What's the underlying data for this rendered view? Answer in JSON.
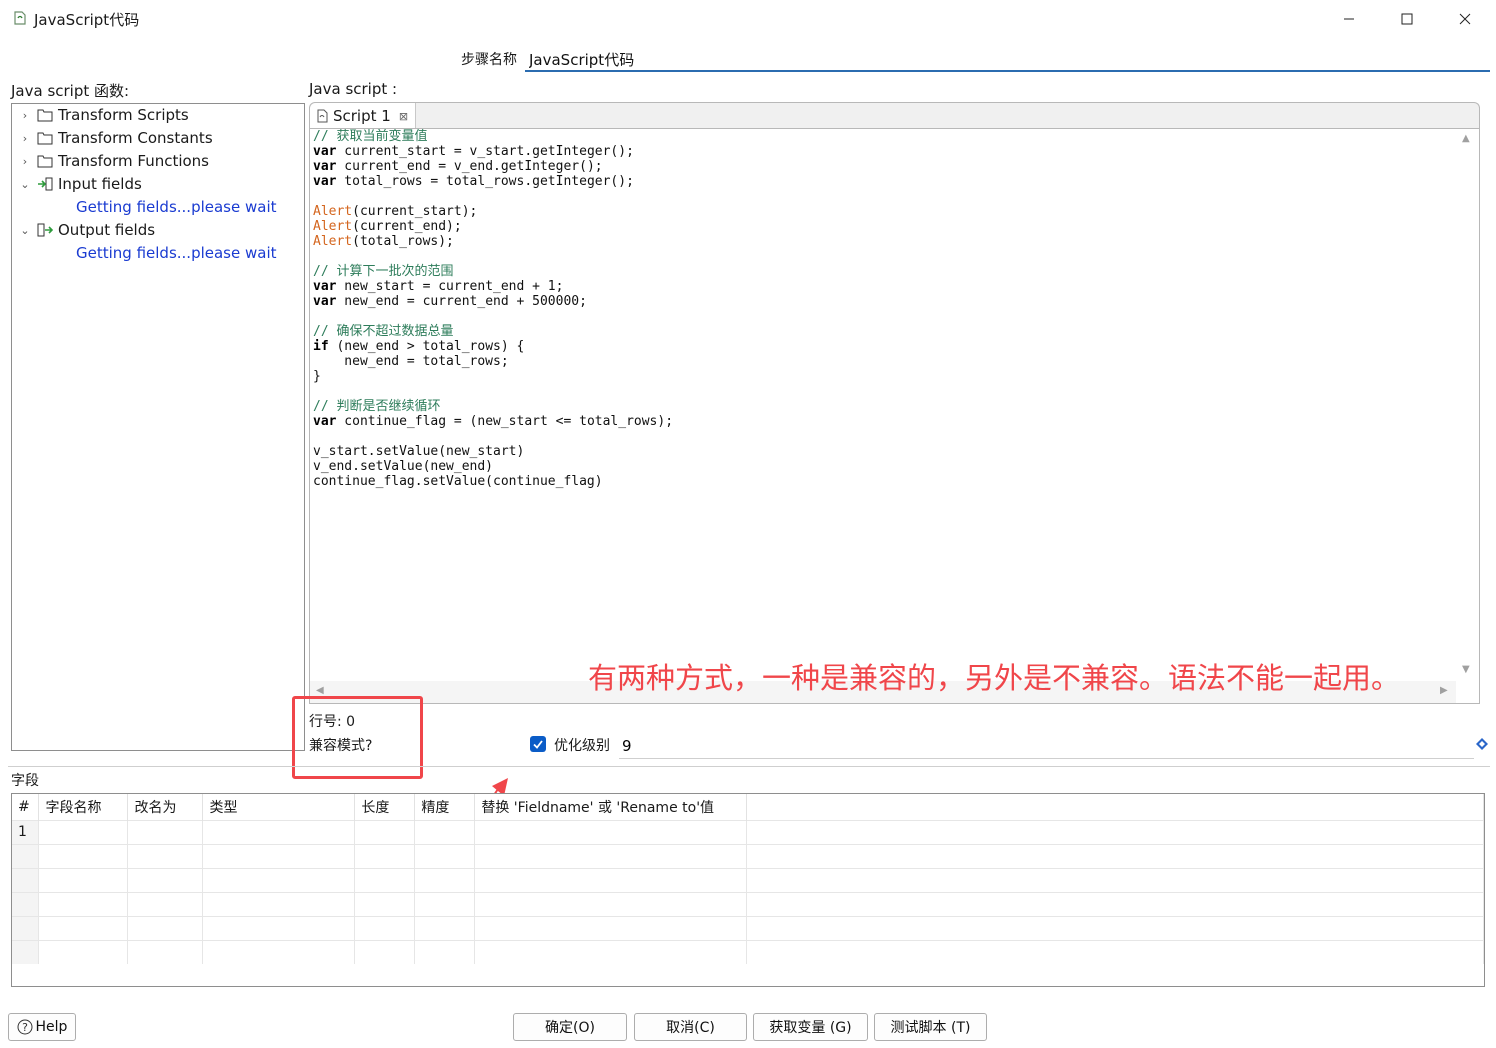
{
  "window": {
    "title": "JavaScript代码",
    "min_icon": "minimize-icon",
    "max_icon": "maximize-icon",
    "close_icon": "close-icon"
  },
  "step": {
    "label": "步骤名称",
    "value": "JavaScript代码"
  },
  "left_panel": {
    "label": "Java script 函数:",
    "tree": [
      {
        "label": "Transform Scripts",
        "icon": "folder-icon",
        "expanded": false
      },
      {
        "label": "Transform Constants",
        "icon": "folder-icon",
        "expanded": false
      },
      {
        "label": "Transform Functions",
        "icon": "folder-icon",
        "expanded": false
      },
      {
        "label": "Input fields",
        "icon": "input-fields-icon",
        "expanded": true,
        "child": "Getting fields...please wait"
      },
      {
        "label": "Output fields",
        "icon": "output-fields-icon",
        "expanded": true,
        "child": "Getting fields...please wait"
      }
    ]
  },
  "editor": {
    "label": "Java script :",
    "tab_label": "Script 1",
    "code_lines": [
      "// 获取当前变量值",
      "var current_start = v_start.getInteger();",
      "var current_end = v_end.getInteger();",
      "var total_rows = total_rows.getInteger();",
      "",
      "Alert(current_start);",
      "Alert(current_end);",
      "Alert(total_rows);",
      "",
      "// 计算下一批次的范围",
      "var new_start = current_end + 1;",
      "var new_end = current_end + 500000;",
      "",
      "// 确保不超过数据总量",
      "if (new_end > total_rows) {",
      "    new_end = total_rows;",
      "}",
      "",
      "// 判断是否继续循环",
      "var continue_flag = (new_start <= total_rows);",
      "",
      "v_start.setValue(new_start)",
      "v_end.setValue(new_end)",
      "continue_flag.setValue(continue_flag)"
    ]
  },
  "annotation": "有两种方式，一种是兼容的，另外是不兼容。语法不能一起用。",
  "status": {
    "line_number": "行号: 0",
    "compat_mode": "兼容模式?"
  },
  "optimization": {
    "checked": true,
    "label": "优化级别",
    "value": "9"
  },
  "fields": {
    "label": "字段",
    "columns": [
      "#",
      "字段名称",
      "改名为",
      "类型",
      "长度",
      "精度",
      "替换 'Fieldname' 或 'Rename to'值"
    ],
    "rows": [
      [
        "1",
        "",
        "",
        "",
        "",
        "",
        ""
      ],
      [
        "",
        "",
        "",
        "",
        "",
        "",
        ""
      ],
      [
        "",
        "",
        "",
        "",
        "",
        "",
        ""
      ],
      [
        "",
        "",
        "",
        "",
        "",
        "",
        ""
      ],
      [
        "",
        "",
        "",
        "",
        "",
        "",
        ""
      ],
      [
        "",
        "",
        "",
        "",
        "",
        "",
        ""
      ]
    ]
  },
  "buttons": {
    "help": "Help",
    "ok": "确定(O)",
    "cancel": "取消(C)",
    "get_vars": "获取变量 (G)",
    "test_script": "测试脚本 (T)"
  },
  "colors": {
    "accent": "#2b6cb0",
    "annotation": "#f0464a",
    "loading_text": "#1a3bd1",
    "comment": "#2e7d5b",
    "function": "#d4661f"
  }
}
